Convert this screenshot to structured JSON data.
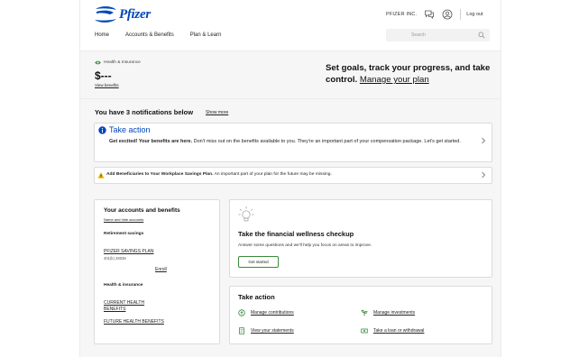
{
  "brand": {
    "name": "Pfizer",
    "color": "#0047bb"
  },
  "header": {
    "company": "PFIZER INC.",
    "logout": "Log out",
    "nav": [
      "Home",
      "Accounts & Benefits",
      "Plan & Learn"
    ],
    "search_placeholder": "Search"
  },
  "hero": {
    "badge": "Health & Insurance",
    "balance": "$---",
    "view_benefits": "View benefits",
    "promo_text": "Set goals, track your progress, and take control.",
    "promo_link": "Manage your plan"
  },
  "notifications": {
    "title": "You have 3 notifications below",
    "show_more": "Show more",
    "take_action": {
      "heading": "Take action",
      "bold": "Get excited! Your benefits are here.",
      "text": " Don't miss out on the benefits available to you. They're an important part of your compensation package. Let's get started."
    },
    "beneficiaries": {
      "bold": "Add Beneficiaries to Your Workplace Savings Plan.",
      "text": " An important part of your plan for the future may be missing."
    }
  },
  "accounts": {
    "title": "Your accounts and benefits",
    "subtitle": "Name and hide accounts",
    "retirement_heading": "Retirement savings",
    "plan_name": "PFIZER SAVINGS PLAN",
    "plan_id": "401(k) 28038",
    "enroll": "Enroll",
    "health_heading": "Health & insurance",
    "current": "CURRENT HEALTH BENEFITS",
    "future": "FUTURE HEALTH BENEFITS"
  },
  "wellness": {
    "title": "Take the financial wellness checkup",
    "description": "Answer some questions and we'll help you focus on areas to improve.",
    "button": "Get started"
  },
  "quick_actions": {
    "title": "Take action",
    "items": [
      "Manage contributions",
      "Manage investments",
      "View your statements",
      "Take a loan or withdrawal"
    ]
  },
  "colors": {
    "accent_green": "#3b8a3b",
    "warning": "#f2b705",
    "link_blue": "#0047bb"
  }
}
